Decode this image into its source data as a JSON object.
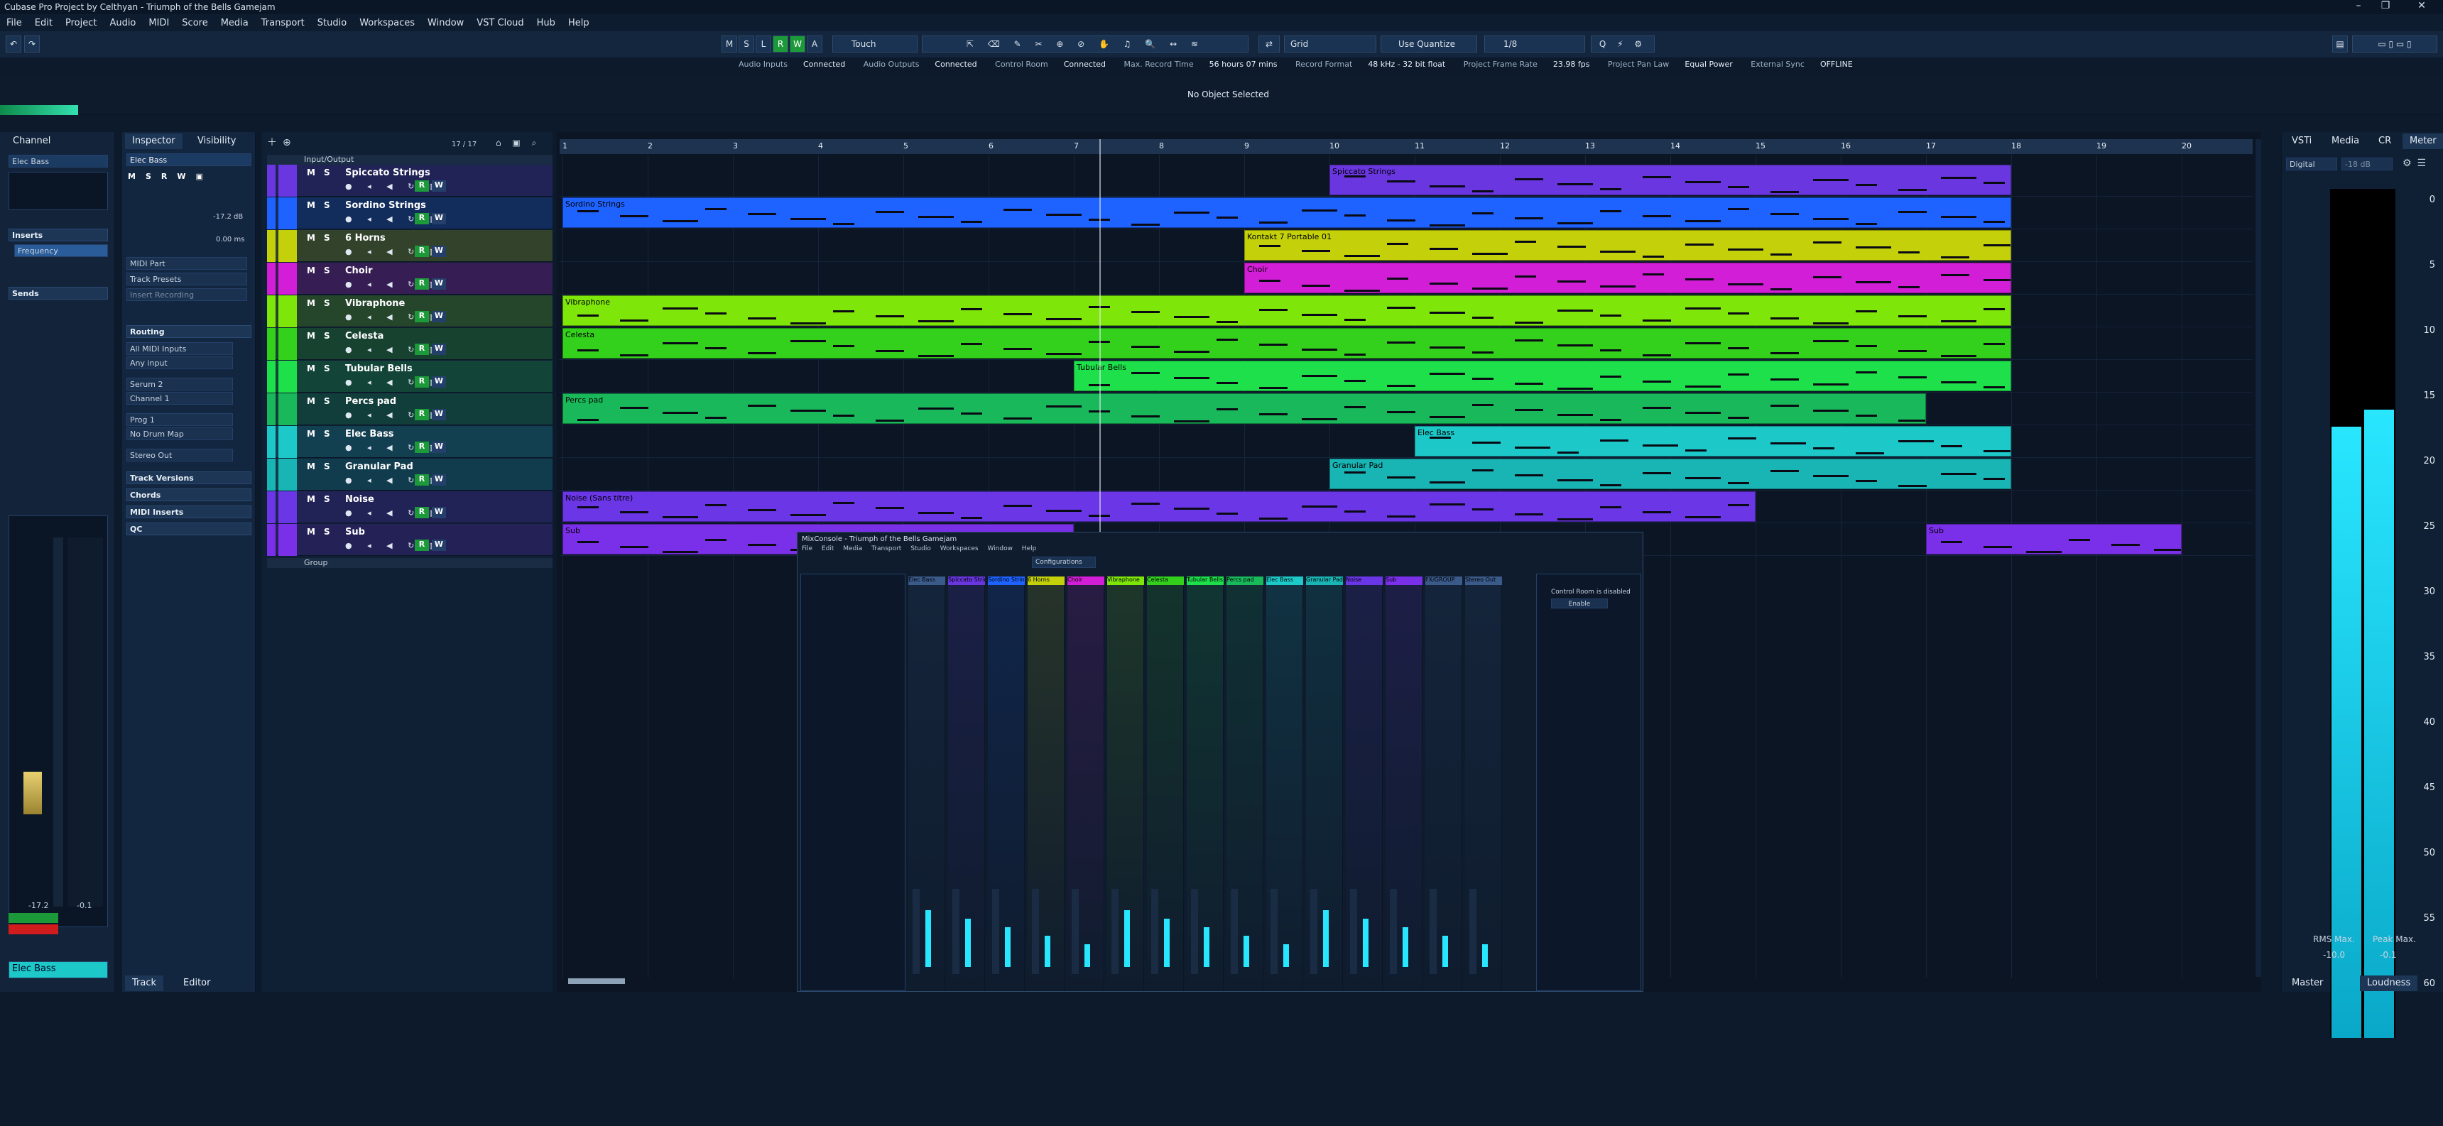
{
  "window": {
    "title": "Cubase Pro Project by Celthyan - Triumph of the Bells Gamejam"
  },
  "menu": [
    "File",
    "Edit",
    "Project",
    "Audio",
    "MIDI",
    "Score",
    "Media",
    "Transport",
    "Studio",
    "Workspaces",
    "Window",
    "VST Cloud",
    "Hub",
    "Help"
  ],
  "toolbar": {
    "modes": [
      "M",
      "S",
      "L",
      "R",
      "W",
      "A"
    ],
    "automation_mode": "Touch",
    "snap_type": "Grid",
    "quantize_mode": "Use Quantize",
    "quantize_value": "1/8"
  },
  "status": {
    "audio_inputs_label": "Audio Inputs",
    "audio_inputs": "Connected",
    "audio_outputs_label": "Audio Outputs",
    "audio_outputs": "Connected",
    "control_room_label": "Control Room",
    "control_room": "Connected",
    "max_record_label": "Max. Record Time",
    "max_record": "56 hours 07 mins",
    "record_format_label": "Record Format",
    "record_format": "48 kHz - 32 bit float",
    "frame_rate_label": "Project Frame Rate",
    "frame_rate": "23.98 fps",
    "pan_law_label": "Project Pan Law",
    "pan_law": "Equal Power",
    "ext_sync_label": "External Sync",
    "ext_sync": "OFFLINE"
  },
  "infoline": {
    "message": "No Object Selected"
  },
  "leftzone": {
    "tab": "Channel",
    "channel_name": "Elec Bass",
    "inserts": "Inserts",
    "insert1": "Frequency",
    "sends": "Sends",
    "fader_left": "-17.2",
    "fader_right": "-0.1",
    "bottom_name": "Elec Bass"
  },
  "inspector": {
    "tabs": [
      "Inspector",
      "Visibility"
    ],
    "track_name": "Elec Bass",
    "volume": "-17.2 dB",
    "delay": "0.00 ms",
    "midi_part": "MIDI Part",
    "track_presets": "Track Presets",
    "insert_recording": "Insert Recording",
    "routing": "Routing",
    "input": "All MIDI Inputs",
    "input2": "Any input",
    "output": "Serum 2",
    "channel": "Channel 1",
    "program": "Prog 1",
    "drum_map": "No Drum Map",
    "out2": "Stereo Out",
    "sections": [
      "Track Versions",
      "Chords",
      "MIDI Inserts",
      "QC"
    ],
    "bottom_tabs": [
      "Track",
      "Editor"
    ]
  },
  "tracklist": {
    "counter": "17 / 17",
    "folder": "Input/Output",
    "group": "Group",
    "tracks": [
      {
        "name": "Spiccato Strings",
        "color": "#6a36e0"
      },
      {
        "name": "Sordino Strings",
        "color": "#1e62ff"
      },
      {
        "name": "6 Horns",
        "color": "#c4d10a"
      },
      {
        "name": "Choir",
        "color": "#d21ed6"
      },
      {
        "name": "Vibraphone",
        "color": "#7fe60a"
      },
      {
        "name": "Celesta",
        "color": "#34d11c"
      },
      {
        "name": "Tubular Bells",
        "color": "#1ee04a"
      },
      {
        "name": "Percs pad",
        "color": "#19b85a"
      },
      {
        "name": "Elec Bass",
        "color": "#1cc8c8"
      },
      {
        "name": "Granular Pad",
        "color": "#19b5b5"
      },
      {
        "name": "Noise",
        "color": "#6a36e6"
      },
      {
        "name": "Sub",
        "color": "#7a2fe8"
      }
    ]
  },
  "ruler": {
    "bars": [
      "1",
      "2",
      "3",
      "4",
      "5",
      "6",
      "7",
      "8",
      "9",
      "10",
      "11",
      "12",
      "13",
      "14",
      "15",
      "16",
      "17",
      "18",
      "19",
      "20"
    ]
  },
  "events": [
    {
      "track": 0,
      "label": "Spiccato Strings",
      "start": 10,
      "end": 18
    },
    {
      "track": 1,
      "label": "Sordino Strings",
      "start": 1,
      "end": 18
    },
    {
      "track": 2,
      "label": "Kontakt 7 Portable 01",
      "start": 9,
      "end": 18
    },
    {
      "track": 3,
      "label": "Choir",
      "start": 9,
      "end": 18
    },
    {
      "track": 4,
      "label": "Vibraphone",
      "start": 1,
      "end": 18
    },
    {
      "track": 5,
      "label": "Celesta",
      "start": 1,
      "end": 18
    },
    {
      "track": 6,
      "label": "Tubular Bells",
      "start": 7,
      "end": 18
    },
    {
      "track": 7,
      "label": "Percs pad",
      "start": 1,
      "end": 17
    },
    {
      "track": 8,
      "label": "Elec Bass",
      "start": 11,
      "end": 18
    },
    {
      "track": 9,
      "label": "Granular Pad",
      "start": 10,
      "end": 18
    },
    {
      "track": 10,
      "label": "Noise (Sans titre)",
      "start": 1,
      "end": 15
    },
    {
      "track": 11,
      "label": "Sub",
      "start": 1,
      "end": 7
    },
    {
      "track": 11,
      "label": "Sub",
      "start": 17,
      "end": 20
    }
  ],
  "mixer": {
    "title": "MixConsole - Triumph of the Bells Gamejam",
    "configurations": "Configurations",
    "cr_text": "Control Room is disabled",
    "cr_button": "Enable",
    "channels": [
      "Elec Bass",
      "Spiccato Strings",
      "Sordino Strings",
      "6 Horns",
      "Choir",
      "Vibraphone",
      "Celesta",
      "Tubular Bells",
      "Percs pad",
      "Elec Bass",
      "Granular Pad",
      "Noise",
      "Sub",
      "FX/GROUP",
      "Stereo Out"
    ]
  },
  "rightzone": {
    "tabs": [
      "VSTi",
      "Media",
      "CR",
      "Meter"
    ],
    "meter_mode": "Digital",
    "meter_ref": "-18 dB",
    "scale": [
      "0",
      "5",
      "10",
      "15",
      "20",
      "25",
      "30",
      "35",
      "40",
      "45",
      "50",
      "55",
      "60"
    ],
    "rms_label": "RMS Max.",
    "peak_label": "Peak Max.",
    "rms": "-10.0",
    "peak": "-0.1",
    "rms_fill": 0.72,
    "peak_fill": 0.74,
    "bottom_tabs": [
      "Master",
      "Loudness"
    ]
  }
}
